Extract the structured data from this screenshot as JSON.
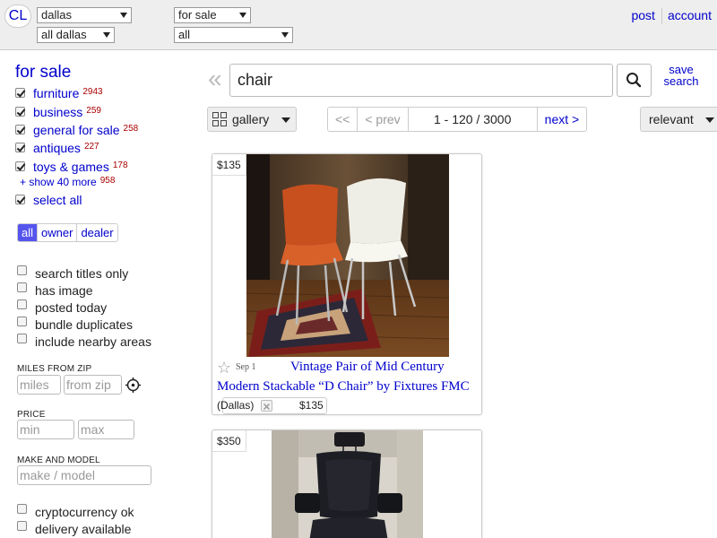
{
  "header": {
    "logo": "CL",
    "area_select": "dallas",
    "subarea_select": "all dallas",
    "category_select": "for sale",
    "subcategory_select": "all",
    "post_link": "post",
    "account_link": "account"
  },
  "sidebar": {
    "title": "for sale",
    "categories": [
      {
        "label": "furniture",
        "count": "2943",
        "checked": true
      },
      {
        "label": "business",
        "count": "259",
        "checked": true
      },
      {
        "label": "general for sale",
        "count": "258",
        "checked": true
      },
      {
        "label": "antiques",
        "count": "227",
        "checked": true
      },
      {
        "label": "toys & games",
        "count": "178",
        "checked": true
      }
    ],
    "show_more": {
      "label": "+ show 40 more",
      "count": "958"
    },
    "select_all": "select all",
    "owner_tabs": [
      "all",
      "owner",
      "dealer"
    ],
    "options": [
      {
        "label": "search titles only",
        "checked": false
      },
      {
        "label": "has image",
        "checked": false
      },
      {
        "label": "posted today",
        "checked": false
      },
      {
        "label": "bundle duplicates",
        "checked": false
      },
      {
        "label": "include nearby areas",
        "checked": false
      }
    ],
    "miles_section": {
      "label": "MILES FROM ZIP",
      "miles_placeholder": "miles",
      "zip_placeholder": "from zip"
    },
    "price_section": {
      "label": "PRICE",
      "min_placeholder": "min",
      "max_placeholder": "max"
    },
    "make_section": {
      "label": "MAKE AND MODEL",
      "placeholder": "make / model"
    },
    "extra_options": [
      {
        "label": "cryptocurrency ok",
        "checked": false
      },
      {
        "label": "delivery available",
        "checked": false
      }
    ]
  },
  "search": {
    "query": "chair",
    "save_label": "save search",
    "prev_glyph": "«"
  },
  "toolbar": {
    "view_label": "gallery",
    "pager": {
      "first": "<<",
      "prev": "< prev",
      "range": "1 - 120 / 3000",
      "next": "next >"
    },
    "sort_label": "relevant"
  },
  "results": [
    {
      "price": "$135",
      "date": "Sep 1",
      "title": "Vintage Pair of Mid Century Modern Stackable “D Chair” by Fixtures FMC",
      "hood": "(Dallas)"
    },
    {
      "price": "$350"
    }
  ],
  "colors": {
    "link": "#0000cc",
    "count": "#aa0000",
    "active_tab": "#5555ee"
  }
}
